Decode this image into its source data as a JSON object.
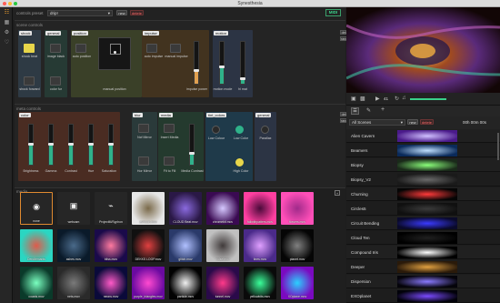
{
  "window": {
    "title": "Synesthesia"
  },
  "top": {
    "controls_preset_label": "controls preset",
    "preset_value": "drip!",
    "new_label": "new",
    "delete_label": "delete",
    "midi_label": "MIDI"
  },
  "scene_controls": {
    "title": "scene controls",
    "default_label": "default",
    "random_label": "random",
    "groups": [
      {
        "label": "shock",
        "controls": [
          "shock beat",
          "shock forward"
        ]
      },
      {
        "label": "general",
        "controls": [
          "image black",
          "color fur"
        ]
      },
      {
        "label": "position",
        "controls": [
          "auto position",
          "manual position"
        ]
      },
      {
        "label": "impulse",
        "controls": [
          "auto impulse",
          "manual impulse",
          "impulse power"
        ]
      },
      {
        "label": "motion",
        "controls": [
          "motion mode",
          "hi mat"
        ]
      }
    ]
  },
  "meta_controls": {
    "title": "meta controls",
    "default_label": "default",
    "random_label": "random",
    "groups": [
      {
        "label": "color",
        "controls": [
          "Brightness",
          "Gamma",
          "Contrast",
          "Hue",
          "Saturation"
        ]
      },
      {
        "label": "blur",
        "controls": [
          "Ncf Mirror",
          "Hor Mirror"
        ]
      },
      {
        "label": "media",
        "controls": [
          "Insert Media",
          "Fit to Fill",
          "Media Contrast"
        ]
      },
      {
        "label": "tint_colors",
        "controls": [
          "Low Colour",
          "Low Color",
          "High Color"
        ]
      },
      {
        "label": "general",
        "controls": [
          "Parallax"
        ]
      }
    ]
  },
  "media": {
    "title": "media",
    "items": [
      {
        "label": "none",
        "icon": "target-icon"
      },
      {
        "label": "webcam",
        "icon": "camera-icon"
      },
      {
        "label": "ProjectM/Syphon",
        "icon": "plug-icon"
      },
      {
        "label": "ashtoon.mov",
        "color1": "#e6e6e6",
        "color2": "#7a6a4a"
      },
      {
        "label": "CLOUD Beat.mov",
        "color1": "#2a1846",
        "color2": "#8a6adf"
      },
      {
        "label": "chromebit.mov",
        "color1": "#3a0a52",
        "color2": "#d6c8ff"
      },
      {
        "label": "fallwithpatters.mov",
        "color1": "#ff3fa0",
        "color2": "#4a0a3a"
      },
      {
        "label": "flowers.mov",
        "color1": "#ff4fb8",
        "color2": "#a02a8a"
      },
      {
        "label": "Dendlemants",
        "color1": "#2ad6c2",
        "color2": "#e05a4a"
      },
      {
        "label": "ashes.mov",
        "color1": "#0a1a2a",
        "color2": "#4a6a8a"
      },
      {
        "label": "bliss.mov",
        "color1": "#1a0a4a",
        "color2": "#ff7aa0"
      },
      {
        "label": "DEKKS LOOP.mov",
        "color1": "#101010",
        "color2": "#e04040"
      },
      {
        "label": "glitch.mov",
        "color1": "#2a3a6a",
        "color2": "#b0c0ff"
      },
      {
        "label": "noise.mov",
        "color1": "#c0c0c0",
        "color2": "#403a3a"
      },
      {
        "label": "lines.mov",
        "color1": "#4a2a8a",
        "color2": "#e0a0ff"
      },
      {
        "label": "planet.mov",
        "color1": "#050505",
        "color2": "#808080"
      },
      {
        "label": "coasts.mov",
        "color1": "#0a3a2a",
        "color2": "#7affc0"
      },
      {
        "label": "nets.mov",
        "color1": "#2a2a2a",
        "color2": "#7a7a7a"
      },
      {
        "label": "neons.mov",
        "color1": "#0a0a3a",
        "color2": "#ff5ac8"
      },
      {
        "label": "purple_triangles.mov",
        "color1": "#6a0aa0",
        "color2": "#ff4ad0"
      },
      {
        "label": "particle.mov",
        "color1": "#020202",
        "color2": "#f0f0f0"
      },
      {
        "label": "tunnel.mov",
        "color1": "#2a0a4a",
        "color2": "#ff3a8a"
      },
      {
        "label": "yellowbits.mov",
        "color1": "#0a0a0a",
        "color2": "#3aff9a"
      },
      {
        "label": "XOplane.mov",
        "color1": "#7a0ac0",
        "color2": "#2ad0ff"
      }
    ]
  },
  "preview": {
    "fps": "41",
    "color1": "#120606",
    "color2": "#e0a040"
  },
  "scenes": {
    "tabs": [
      "list-icon",
      "pencil-icon",
      "plus-icon"
    ],
    "filter_value": "All Scenes",
    "new_label": "new",
    "delete_label": "delete",
    "time_label": "00h 00m 00s",
    "items": [
      {
        "name": "Alien Cavern",
        "color1": "#4a1a8a",
        "color2": "#d0c0ff"
      },
      {
        "name": "Beamers",
        "color1": "#0a2a5a",
        "color2": "#c0e0ff"
      },
      {
        "name": "Biopsy",
        "color1": "#1a2a1a",
        "color2": "#8aff7a"
      },
      {
        "name": "Biopsy_V2",
        "color1": "#1a1a1a",
        "color2": "#6a6a6a"
      },
      {
        "name": "Churning",
        "color1": "#050505",
        "color2": "#ff3a3a"
      },
      {
        "name": "Circles5",
        "color1": "#101010",
        "color2": "#3a3a3a"
      },
      {
        "name": "Circuit Bending",
        "color1": "#0a0a2a",
        "color2": "#3a3aff"
      },
      {
        "name": "Cloud Ten",
        "color1": "#000000",
        "color2": "#202020"
      },
      {
        "name": "Compound Iris",
        "color1": "#000000",
        "color2": "#ffffff"
      },
      {
        "name": "Deeper",
        "color1": "#2a1a0a",
        "color2": "#e0a040"
      },
      {
        "name": "Dispersion",
        "color1": "#05040a",
        "color2": "#8a7aff"
      },
      {
        "name": "EXOplanet",
        "color1": "#02020a",
        "color2": "#7a4aff"
      }
    ]
  }
}
